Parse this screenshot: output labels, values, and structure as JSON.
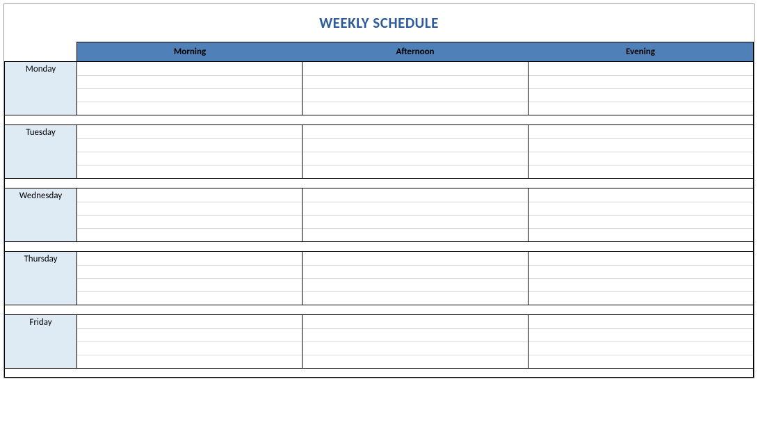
{
  "title": "WEEKLY SCHEDULE",
  "columns": [
    "Morning",
    "Afternoon",
    "Evening"
  ],
  "days": [
    {
      "name": "Monday",
      "rows": [
        [
          "",
          "",
          ""
        ],
        [
          "",
          "",
          ""
        ],
        [
          "",
          "",
          ""
        ],
        [
          "",
          "",
          ""
        ]
      ]
    },
    {
      "name": "Tuesday",
      "rows": [
        [
          "",
          "",
          ""
        ],
        [
          "",
          "",
          ""
        ],
        [
          "",
          "",
          ""
        ],
        [
          "",
          "",
          ""
        ]
      ]
    },
    {
      "name": "Wednesday",
      "rows": [
        [
          "",
          "",
          ""
        ],
        [
          "",
          "",
          ""
        ],
        [
          "",
          "",
          ""
        ],
        [
          "",
          "",
          ""
        ]
      ]
    },
    {
      "name": "Thursday",
      "rows": [
        [
          "",
          "",
          ""
        ],
        [
          "",
          "",
          ""
        ],
        [
          "",
          "",
          ""
        ],
        [
          "",
          "",
          ""
        ]
      ]
    },
    {
      "name": "Friday",
      "rows": [
        [
          "",
          "",
          ""
        ],
        [
          "",
          "",
          ""
        ],
        [
          "",
          "",
          ""
        ],
        [
          "",
          "",
          ""
        ]
      ]
    }
  ],
  "colors": {
    "title": "#2E5C9A",
    "headerBand": "#4F81B8",
    "dayLabel": "#DEEBF5"
  }
}
